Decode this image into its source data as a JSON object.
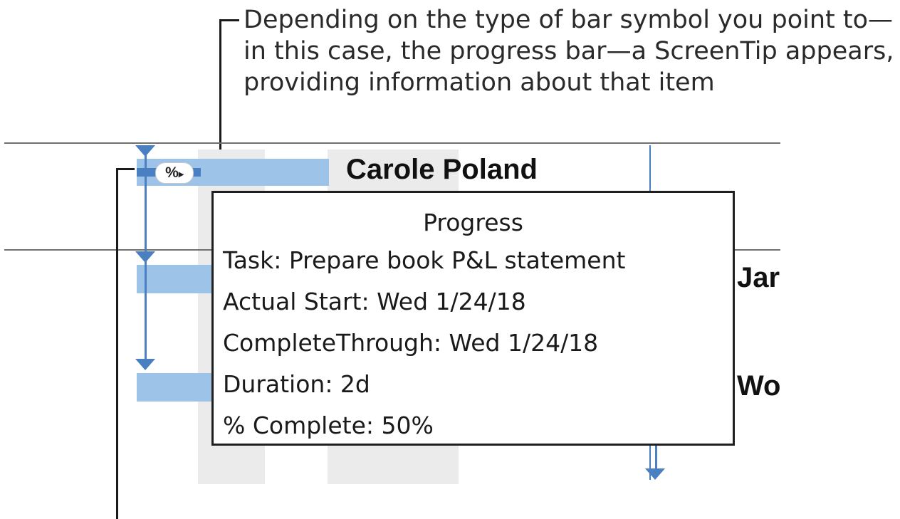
{
  "callout": {
    "lines": [
      "Depending on the type of bar symbol you point to—",
      "in this case, the progress bar—a ScreenTip appears,",
      "providing information about that item"
    ]
  },
  "gantt": {
    "resource_name": "Carole Poland",
    "partial_label_row2": "Jar",
    "partial_label_row3": "Wo",
    "progress_symbol": "%"
  },
  "screentip": {
    "title": "Progress",
    "task": "Task: Prepare book P&L statement",
    "actual_start": "Actual Start: Wed 1/24/18",
    "complete_through": "CompleteThrough: Wed 1/24/18",
    "duration": "Duration: 2d",
    "percent_complete": "% Complete: 50%"
  },
  "colors": {
    "bar": "#9ec3e8",
    "connector": "#4a7fc1",
    "shade": "#ebebeb"
  }
}
